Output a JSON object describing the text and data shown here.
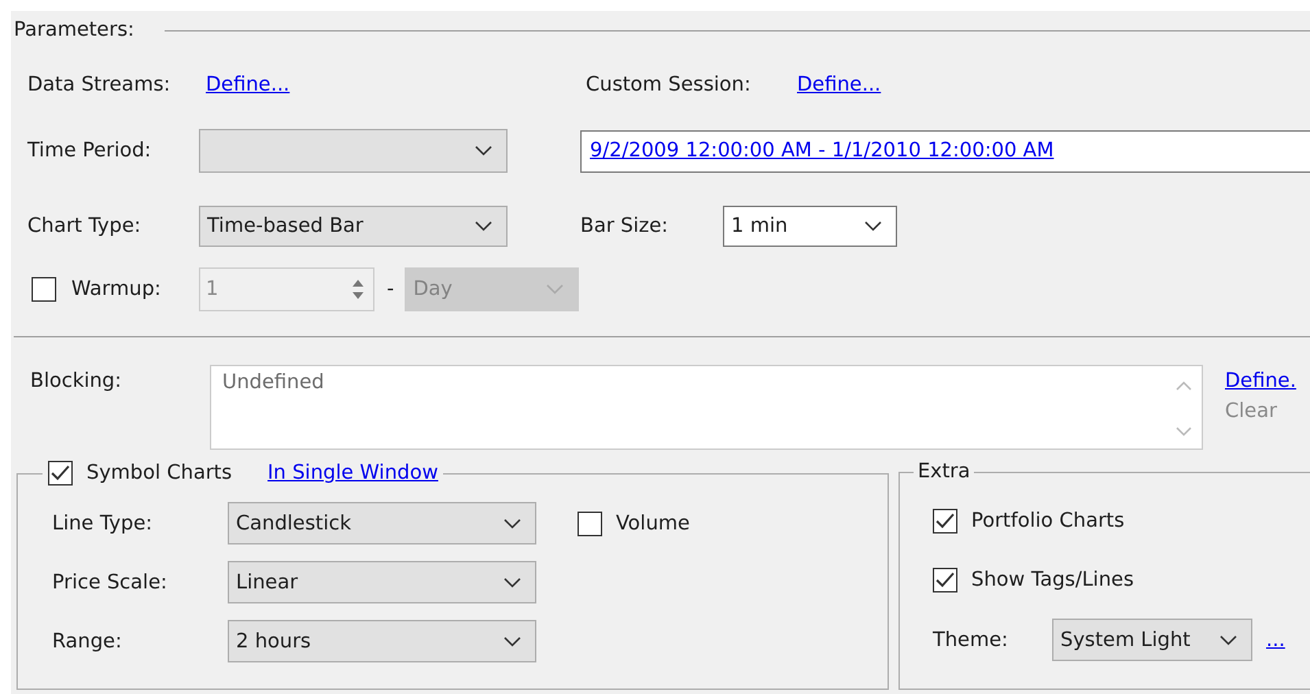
{
  "section_title": "Parameters:",
  "data_streams": {
    "label": "Data Streams:",
    "link": "Define..."
  },
  "custom_session": {
    "label": "Custom Session:",
    "link": "Define..."
  },
  "time_period": {
    "label": "Time Period:"
  },
  "date_range": "9/2/2009 12:00:00 AM - 1/1/2010 12:00:00 AM",
  "chart_type": {
    "label": "Chart Type:",
    "value": "Time-based Bar"
  },
  "bar_size": {
    "label": "Bar Size:",
    "value": "1 min"
  },
  "warmup": {
    "label": "Warmup:",
    "checked": false,
    "disabled": true,
    "value": "1",
    "separator": "-",
    "unit": "Day"
  },
  "blocking": {
    "label": "Blocking:",
    "value": "Undefined",
    "define_link": "Define.",
    "clear": "Clear",
    "clear_disabled": true
  },
  "symbol_charts": {
    "label": "Symbol Charts",
    "checked": true,
    "link": "In Single Window",
    "fields": [
      {
        "label": "Line Type:",
        "value": "Candlestick"
      },
      {
        "label": "Price Scale:",
        "value": "Linear"
      },
      {
        "label": "Range:",
        "value": "2 hours"
      }
    ],
    "volume": {
      "label": "Volume",
      "checked": false
    }
  },
  "extra": {
    "title": "Extra",
    "options": [
      {
        "label": "Portfolio Charts",
        "checked": true
      },
      {
        "label": "Show Tags/Lines",
        "checked": true
      }
    ],
    "theme": {
      "label": "Theme:",
      "value": "System Light"
    },
    "more_link": "..."
  }
}
